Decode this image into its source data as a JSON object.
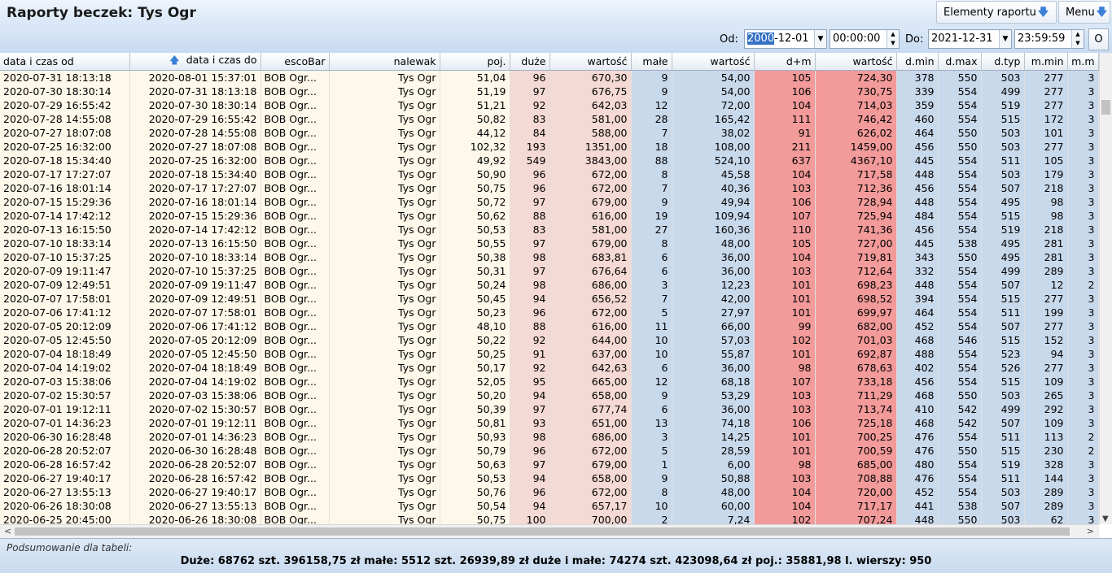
{
  "title": "Raporty beczek: Tys Ogr",
  "toolbar": {
    "elements_label": "Elementy raportu",
    "menu_label": "Menu"
  },
  "filter": {
    "from_label": "Od:",
    "from_date_selected": "2000",
    "from_date_rest": "-12-01",
    "from_time": "00:00:00",
    "to_label": "Do:",
    "to_date": "2021-12-31",
    "to_time": "23:59:59",
    "o_button": "O"
  },
  "columns": [
    "data i czas od",
    "data i czas do",
    "escoBar",
    "nalewak",
    "poj.",
    "duże",
    "wartość",
    "małe",
    "wartość",
    "d+m",
    "wartość",
    "d.min",
    "d.max",
    "d.typ",
    "m.min",
    "m.m"
  ],
  "rows": [
    [
      "2020-07-31 18:13:18",
      "2020-08-01 15:37:01",
      "BOB Ogr...",
      "Tys Ogr",
      "51,04",
      "96",
      "670,30",
      "9",
      "54,00",
      "105",
      "724,30",
      "378",
      "550",
      "503",
      "277",
      "3"
    ],
    [
      "2020-07-30 18:30:14",
      "2020-07-31 18:13:18",
      "BOB Ogr...",
      "Tys Ogr",
      "51,19",
      "97",
      "676,75",
      "9",
      "54,00",
      "106",
      "730,75",
      "339",
      "554",
      "499",
      "277",
      "3"
    ],
    [
      "2020-07-29 16:55:42",
      "2020-07-30 18:30:14",
      "BOB Ogr...",
      "Tys Ogr",
      "51,21",
      "92",
      "642,03",
      "12",
      "72,00",
      "104",
      "714,03",
      "359",
      "554",
      "519",
      "277",
      "3"
    ],
    [
      "2020-07-28 14:55:08",
      "2020-07-29 16:55:42",
      "BOB Ogr...",
      "Tys Ogr",
      "50,82",
      "83",
      "581,00",
      "28",
      "165,42",
      "111",
      "746,42",
      "460",
      "554",
      "515",
      "172",
      "3"
    ],
    [
      "2020-07-27 18:07:08",
      "2020-07-28 14:55:08",
      "BOB Ogr...",
      "Tys Ogr",
      "44,12",
      "84",
      "588,00",
      "7",
      "38,02",
      "91",
      "626,02",
      "464",
      "550",
      "503",
      "101",
      "3"
    ],
    [
      "2020-07-25 16:32:00",
      "2020-07-27 18:07:08",
      "BOB Ogr...",
      "Tys Ogr",
      "102,32",
      "193",
      "1351,00",
      "18",
      "108,00",
      "211",
      "1459,00",
      "456",
      "550",
      "503",
      "277",
      "3"
    ],
    [
      "2020-07-18 15:34:40",
      "2020-07-25 16:32:00",
      "BOB Ogr...",
      "Tys Ogr",
      "49,92",
      "549",
      "3843,00",
      "88",
      "524,10",
      "637",
      "4367,10",
      "445",
      "554",
      "511",
      "105",
      "3"
    ],
    [
      "2020-07-17 17:27:07",
      "2020-07-18 15:34:40",
      "BOB Ogr...",
      "Tys Ogr",
      "50,90",
      "96",
      "672,00",
      "8",
      "45,58",
      "104",
      "717,58",
      "448",
      "554",
      "503",
      "179",
      "3"
    ],
    [
      "2020-07-16 18:01:14",
      "2020-07-17 17:27:07",
      "BOB Ogr...",
      "Tys Ogr",
      "50,75",
      "96",
      "672,00",
      "7",
      "40,36",
      "103",
      "712,36",
      "456",
      "554",
      "507",
      "218",
      "3"
    ],
    [
      "2020-07-15 15:29:36",
      "2020-07-16 18:01:14",
      "BOB Ogr...",
      "Tys Ogr",
      "50,72",
      "97",
      "679,00",
      "9",
      "49,94",
      "106",
      "728,94",
      "448",
      "554",
      "495",
      "98",
      "3"
    ],
    [
      "2020-07-14 17:42:12",
      "2020-07-15 15:29:36",
      "BOB Ogr...",
      "Tys Ogr",
      "50,62",
      "88",
      "616,00",
      "19",
      "109,94",
      "107",
      "725,94",
      "484",
      "554",
      "515",
      "98",
      "3"
    ],
    [
      "2020-07-13 16:15:50",
      "2020-07-14 17:42:12",
      "BOB Ogr...",
      "Tys Ogr",
      "50,53",
      "83",
      "581,00",
      "27",
      "160,36",
      "110",
      "741,36",
      "456",
      "554",
      "519",
      "218",
      "3"
    ],
    [
      "2020-07-10 18:33:14",
      "2020-07-13 16:15:50",
      "BOB Ogr...",
      "Tys Ogr",
      "50,55",
      "97",
      "679,00",
      "8",
      "48,00",
      "105",
      "727,00",
      "445",
      "538",
      "495",
      "281",
      "3"
    ],
    [
      "2020-07-10 15:37:25",
      "2020-07-10 18:33:14",
      "BOB Ogr...",
      "Tys Ogr",
      "50,38",
      "98",
      "683,81",
      "6",
      "36,00",
      "104",
      "719,81",
      "343",
      "550",
      "495",
      "281",
      "3"
    ],
    [
      "2020-07-09 19:11:47",
      "2020-07-10 15:37:25",
      "BOB Ogr...",
      "Tys Ogr",
      "50,31",
      "97",
      "676,64",
      "6",
      "36,00",
      "103",
      "712,64",
      "332",
      "554",
      "499",
      "289",
      "3"
    ],
    [
      "2020-07-09 12:49:51",
      "2020-07-09 19:11:47",
      "BOB Ogr...",
      "Tys Ogr",
      "50,24",
      "98",
      "686,00",
      "3",
      "12,23",
      "101",
      "698,23",
      "448",
      "554",
      "507",
      "12",
      "2"
    ],
    [
      "2020-07-07 17:58:01",
      "2020-07-09 12:49:51",
      "BOB Ogr...",
      "Tys Ogr",
      "50,45",
      "94",
      "656,52",
      "7",
      "42,00",
      "101",
      "698,52",
      "394",
      "554",
      "515",
      "277",
      "3"
    ],
    [
      "2020-07-06 17:41:12",
      "2020-07-07 17:58:01",
      "BOB Ogr...",
      "Tys Ogr",
      "50,23",
      "96",
      "672,00",
      "5",
      "27,97",
      "101",
      "699,97",
      "464",
      "554",
      "511",
      "199",
      "3"
    ],
    [
      "2020-07-05 20:12:09",
      "2020-07-06 17:41:12",
      "BOB Ogr...",
      "Tys Ogr",
      "48,10",
      "88",
      "616,00",
      "11",
      "66,00",
      "99",
      "682,00",
      "452",
      "554",
      "507",
      "277",
      "3"
    ],
    [
      "2020-07-05 12:45:50",
      "2020-07-05 20:12:09",
      "BOB Ogr...",
      "Tys Ogr",
      "50,22",
      "92",
      "644,00",
      "10",
      "57,03",
      "102",
      "701,03",
      "468",
      "546",
      "515",
      "152",
      "3"
    ],
    [
      "2020-07-04 18:18:49",
      "2020-07-05 12:45:50",
      "BOB Ogr...",
      "Tys Ogr",
      "50,25",
      "91",
      "637,00",
      "10",
      "55,87",
      "101",
      "692,87",
      "488",
      "554",
      "523",
      "94",
      "3"
    ],
    [
      "2020-07-04 14:19:02",
      "2020-07-04 18:18:49",
      "BOB Ogr...",
      "Tys Ogr",
      "50,17",
      "92",
      "642,63",
      "6",
      "36,00",
      "98",
      "678,63",
      "402",
      "554",
      "526",
      "277",
      "3"
    ],
    [
      "2020-07-03 15:38:06",
      "2020-07-04 14:19:02",
      "BOB Ogr...",
      "Tys Ogr",
      "52,05",
      "95",
      "665,00",
      "12",
      "68,18",
      "107",
      "733,18",
      "456",
      "554",
      "515",
      "109",
      "3"
    ],
    [
      "2020-07-02 15:30:57",
      "2020-07-03 15:38:06",
      "BOB Ogr...",
      "Tys Ogr",
      "50,20",
      "94",
      "658,00",
      "9",
      "53,29",
      "103",
      "711,29",
      "468",
      "550",
      "503",
      "265",
      "3"
    ],
    [
      "2020-07-01 19:12:11",
      "2020-07-02 15:30:57",
      "BOB Ogr...",
      "Tys Ogr",
      "50,39",
      "97",
      "677,74",
      "6",
      "36,00",
      "103",
      "713,74",
      "410",
      "542",
      "499",
      "292",
      "3"
    ],
    [
      "2020-07-01 14:36:23",
      "2020-07-01 19:12:11",
      "BOB Ogr...",
      "Tys Ogr",
      "50,81",
      "93",
      "651,00",
      "13",
      "74,18",
      "106",
      "725,18",
      "468",
      "542",
      "507",
      "109",
      "3"
    ],
    [
      "2020-06-30 16:28:48",
      "2020-07-01 14:36:23",
      "BOB Ogr...",
      "Tys Ogr",
      "50,93",
      "98",
      "686,00",
      "3",
      "14,25",
      "101",
      "700,25",
      "476",
      "554",
      "511",
      "113",
      "2"
    ],
    [
      "2020-06-28 20:52:07",
      "2020-06-30 16:28:48",
      "BOB Ogr...",
      "Tys Ogr",
      "50,79",
      "96",
      "672,00",
      "5",
      "28,59",
      "101",
      "700,59",
      "476",
      "550",
      "515",
      "230",
      "2"
    ],
    [
      "2020-06-28 16:57:42",
      "2020-06-28 20:52:07",
      "BOB Ogr...",
      "Tys Ogr",
      "50,63",
      "97",
      "679,00",
      "1",
      "6,00",
      "98",
      "685,00",
      "480",
      "554",
      "519",
      "328",
      "3"
    ],
    [
      "2020-06-27 19:40:17",
      "2020-06-28 16:57:42",
      "BOB Ogr...",
      "Tys Ogr",
      "50,53",
      "94",
      "658,00",
      "9",
      "50,88",
      "103",
      "708,88",
      "476",
      "554",
      "511",
      "144",
      "3"
    ],
    [
      "2020-06-27 13:55:13",
      "2020-06-27 19:40:17",
      "BOB Ogr...",
      "Tys Ogr",
      "50,76",
      "96",
      "672,00",
      "8",
      "48,00",
      "104",
      "720,00",
      "452",
      "554",
      "503",
      "289",
      "3"
    ],
    [
      "2020-06-26 18:30:08",
      "2020-06-27 13:55:13",
      "BOB Ogr...",
      "Tys Ogr",
      "50,54",
      "94",
      "657,17",
      "10",
      "60,00",
      "104",
      "717,17",
      "441",
      "538",
      "507",
      "289",
      "3"
    ],
    [
      "2020-06-25 20:45:00",
      "2020-06-26 18:30:08",
      "BOB Ogr...",
      "Tys Ogr",
      "50,75",
      "100",
      "700,00",
      "2",
      "7,24",
      "102",
      "707,24",
      "448",
      "550",
      "503",
      "62",
      "3"
    ]
  ],
  "summary": {
    "label": "Podsumowanie dla tabeli:",
    "text": "Duże: 68762 szt. 396158,75 zł małe: 5512 szt. 26939,89 zł duże i małe: 74274 szt. 423098,64 zł poj.: 35881,98 l. wierszy: 950"
  },
  "colors": {
    "cream": "#fdf8e9",
    "pink": "#f4d9d4",
    "blue": "#c9d9ec",
    "red": "#f39a9a",
    "header": "#d8e6f7"
  }
}
